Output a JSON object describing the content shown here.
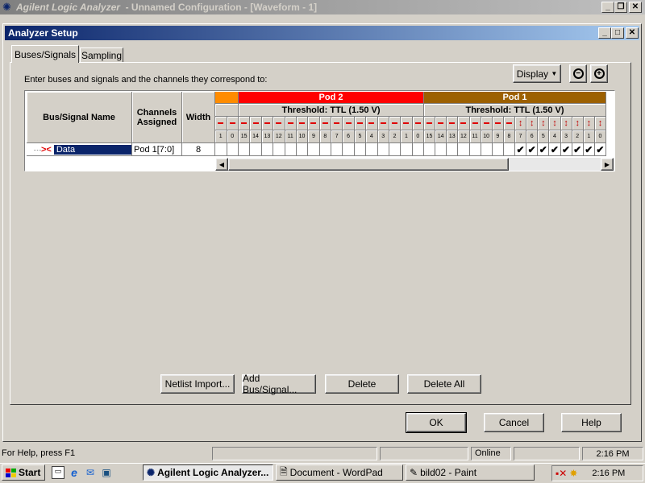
{
  "app": {
    "title_app": "Agilent Logic Analyzer",
    "title_rest": "- Unnamed Configuration - [Waveform - 1]"
  },
  "dialog": {
    "title": "Analyzer Setup",
    "tabs": [
      "Buses/Signals",
      "Sampling"
    ],
    "instruction": "Enter buses and signals and the channels they correspond to:",
    "display_button": "Display",
    "zoom_out_icon": "zoom-out-icon",
    "zoom_in_icon": "zoom-in-icon"
  },
  "table": {
    "headers": {
      "name": "Bus/Signal Name",
      "channels": "Channels Assigned",
      "width": "Width"
    },
    "pods": [
      {
        "label": "Pod 2",
        "threshold": "Threshold: TTL (1.50 V)",
        "color": "#ff0000"
      },
      {
        "label": "Pod 1",
        "threshold": "Threshold: TTL (1.50 V)",
        "color": "#9c6000"
      }
    ],
    "pre_pod": {
      "color": "#ff8c00",
      "channels": [
        "1",
        "0"
      ]
    },
    "pod2_channels": [
      "15",
      "14",
      "13",
      "12",
      "11",
      "10",
      "9",
      "8",
      "7",
      "6",
      "5",
      "4",
      "3",
      "2",
      "1",
      "0"
    ],
    "pod1_channels": [
      "15",
      "14",
      "13",
      "12",
      "11",
      "10",
      "9",
      "8",
      "7",
      "6",
      "5",
      "4",
      "3",
      "2",
      "1",
      "0"
    ],
    "rows": [
      {
        "name": "Data",
        "channels": "Pod 1[7:0]",
        "width": "8",
        "icon": "bus-icon"
      }
    ]
  },
  "buttons": {
    "netlist": "Netlist Import...",
    "add": "Add Bus/Signal...",
    "delete": "Delete",
    "delete_all": "Delete All",
    "ok": "OK",
    "cancel": "Cancel",
    "help": "Help"
  },
  "status": {
    "help_text": "For Help, press F1",
    "online": "Online",
    "time": "2:16 PM"
  },
  "taskbar": {
    "start": "Start",
    "tasks": [
      "Agilent Logic Analyzer...",
      "Document - WordPad",
      "bild02 - Paint"
    ],
    "clock": "2:16 PM"
  },
  "colors": {
    "titlebar_active": "#0a246a",
    "titlebar_inactive": "#808080",
    "selection": "#0a246a"
  }
}
